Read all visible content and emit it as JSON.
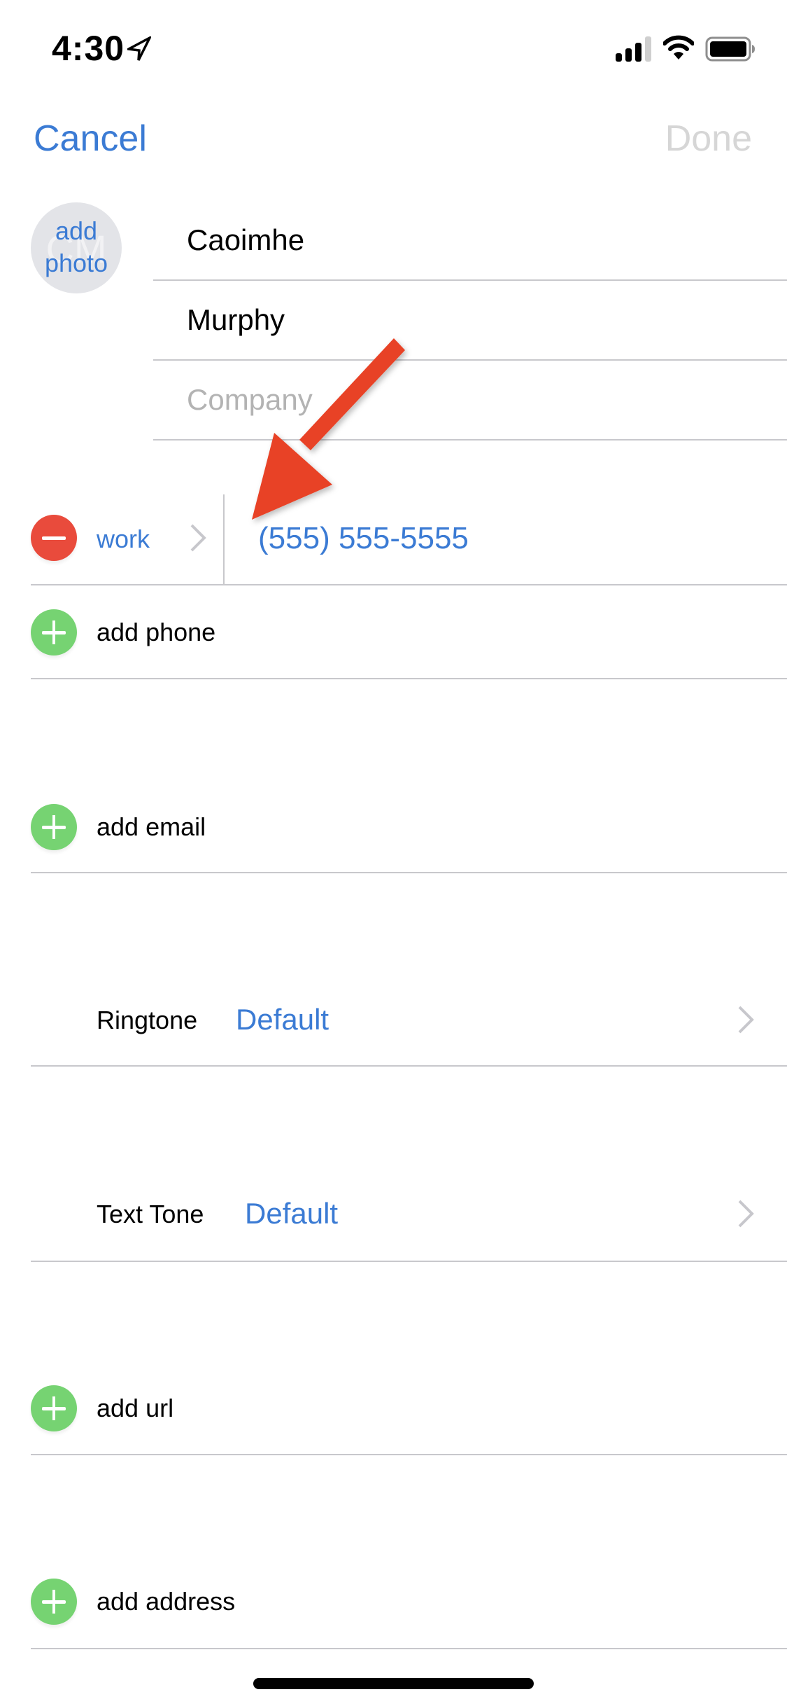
{
  "status_bar": {
    "time": "4:30",
    "icons": [
      "location-arrow-icon",
      "cellular-signal-icon",
      "wifi-icon",
      "battery-icon"
    ]
  },
  "nav": {
    "cancel_label": "Cancel",
    "done_label": "Done"
  },
  "avatar": {
    "initials": "CM",
    "label_line1": "add",
    "label_line2": "photo"
  },
  "name_fields": {
    "first_name": "Caoimhe",
    "last_name": "Murphy",
    "company_placeholder": "Company"
  },
  "phone": {
    "label": "work",
    "number": "(555) 555-5555"
  },
  "rows": {
    "add_phone": "add phone",
    "add_email": "add email",
    "ringtone_label": "Ringtone",
    "ringtone_value": "Default",
    "text_tone_label": "Text Tone",
    "text_tone_value": "Default",
    "add_url": "add url",
    "add_address": "add address"
  },
  "annotation": {
    "type": "arrow",
    "color": "#e84228",
    "points_to": "phone-number-field"
  },
  "colors": {
    "accent": "#3b7bd4",
    "delete": "#e94b3c",
    "add": "#76d372",
    "disabled": "#d6d6d6",
    "separator": "#c8c8cc"
  }
}
